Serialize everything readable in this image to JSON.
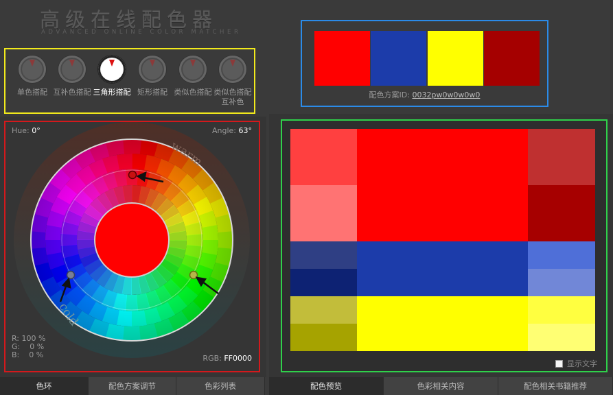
{
  "logo": {
    "title": "高级在线配色器",
    "subtitle": "ADVANCED ONLINE COLOR MATCHER"
  },
  "scheme_types": [
    {
      "label": "单色搭配",
      "active": false
    },
    {
      "label": "互补色搭配",
      "active": false
    },
    {
      "label": "三角形搭配",
      "active": true
    },
    {
      "label": "矩形搭配",
      "active": false
    },
    {
      "label": "类似色搭配",
      "active": false
    },
    {
      "label": "类似色搭配互补色",
      "active": false
    }
  ],
  "palette": {
    "colors": [
      "#ff0000",
      "#1c3caa",
      "#ffff00",
      "#a50000"
    ],
    "id_label": "配色方案ID:",
    "id_value": "0032pw0w0w0w0"
  },
  "wheel": {
    "hue_label": "Hue:",
    "hue_value": "0°",
    "angle_label": "Angle:",
    "angle_value": "63°",
    "warm_label": "warm",
    "cold_label": "cold",
    "center_color": "#ff0000",
    "r_label": "R:",
    "r_value": "100 %",
    "g_label": "G:",
    "g_value": "0 %",
    "b_label": "B:",
    "b_value": "0 %",
    "rgb_label": "RGB:",
    "rgb_value": "FF0000"
  },
  "preview": {
    "rows": [
      {
        "left": [
          "#ff4040",
          "#ff7373"
        ],
        "main": "#ff0000",
        "right": [
          "#bf3030",
          "#a60000"
        ]
      },
      {
        "left": [
          "#2f3f84",
          "#0d2273"
        ],
        "main": "#1c3caa",
        "right": [
          "#4f6fd8",
          "#7187d7"
        ]
      },
      {
        "left": [
          "#c2bd3a",
          "#a6a300"
        ],
        "main": "#ffff00",
        "right": [
          "#ffff40",
          "#ffff73"
        ]
      }
    ],
    "show_text_label": "显示文字"
  },
  "left_tabs": [
    "色环",
    "配色方案调节",
    "色彩列表"
  ],
  "right_tabs": [
    "配色预览",
    "色彩相关内容",
    "配色相关书籍推荐"
  ]
}
